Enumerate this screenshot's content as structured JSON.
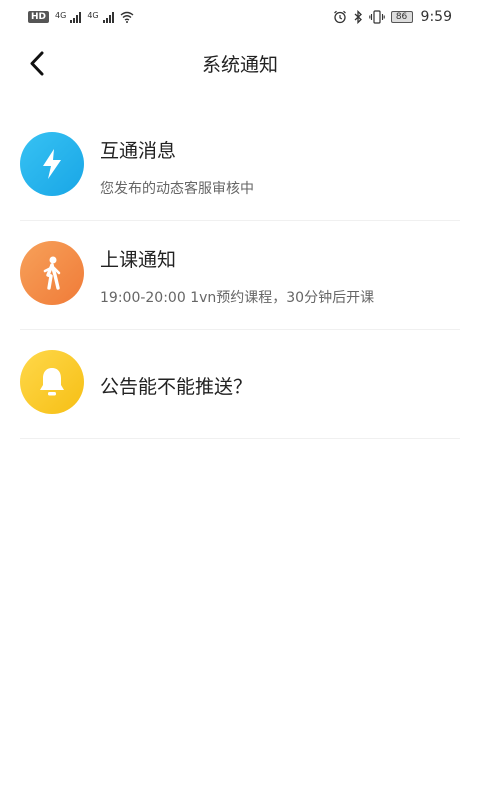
{
  "status_bar": {
    "hd_label": "HD",
    "signal1_label": "4G",
    "signal2_label": "4G",
    "battery": "86",
    "time": "9:59",
    "icons": [
      "hd-icon",
      "signal-icon",
      "wifi-icon",
      "alarm-icon",
      "bluetooth-icon",
      "vibrate-icon",
      "battery-icon"
    ]
  },
  "header": {
    "title": "系统通知"
  },
  "notifications": [
    {
      "title": "互通消息",
      "subtitle": "您发布的动态客服审核中",
      "icon": "lightning-icon",
      "color": "#23b3ee"
    },
    {
      "title": "上课通知",
      "subtitle": "19:00-20:00 1vn预约课程，30分钟后开课",
      "icon": "walking-person-icon",
      "color": "#f28a43"
    },
    {
      "title": "公告能不能推送？",
      "subtitle": "",
      "icon": "bell-icon",
      "color": "#f9c926"
    }
  ]
}
